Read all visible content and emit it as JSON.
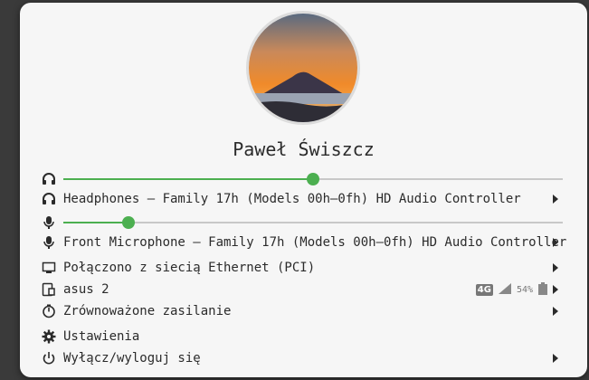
{
  "user": {
    "name": "Paweł Świszcz"
  },
  "output_volume": {
    "level": 0.5
  },
  "output_device": {
    "label": "Headphones – Family 17h (Models 00h–0fh) HD Audio Controller"
  },
  "input_volume": {
    "level": 0.13
  },
  "input_device": {
    "label": "Front Microphone – Family 17h (Models 00h–0fh) HD Audio Controller"
  },
  "network": {
    "label": "Połączono z siecią Ethernet (PCI)"
  },
  "mobile": {
    "label": "asus 2",
    "network_type": "4G",
    "battery": "54%"
  },
  "power_mode": {
    "label": "Zrównoważone zasilanie"
  },
  "settings": {
    "label": "Ustawienia"
  },
  "power_off": {
    "label": "Wyłącz/wyloguj się"
  },
  "colors": {
    "accent": "#4caf50",
    "panel": "#f6f6f6",
    "text": "#2b2b2b"
  }
}
